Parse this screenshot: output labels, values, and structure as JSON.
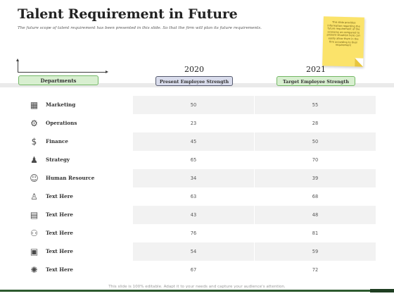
{
  "slide": {
    "title": "Talent Requirement in Future",
    "subtitle": "The  future scope of talent requirement  has been presented  in this slide. So that the firm will plan its future requirements.",
    "sticky_note": "This slide provides information regarding the future requirement of the economy as compared to present situation here can easily allow them in the firm according to their requirement"
  },
  "table": {
    "year_1": "2020",
    "year_2": "2021",
    "departments_header": "Departments",
    "col1_header": "Present Employee Strength",
    "col2_header": "Target Employee Strength",
    "rows": [
      {
        "name": "Marketing",
        "icon": "marketing-icon",
        "glyph": "▦",
        "present": "50",
        "target": "55"
      },
      {
        "name": "Operations",
        "icon": "gears-icon",
        "glyph": "⚙",
        "present": "23",
        "target": "28"
      },
      {
        "name": "Finance",
        "icon": "money-bag-icon",
        "glyph": "$",
        "present": "45",
        "target": "50"
      },
      {
        "name": "Strategy",
        "icon": "strategy-icon",
        "glyph": "♟",
        "present": "65",
        "target": "70"
      },
      {
        "name": "Human Resource",
        "icon": "hr-icon",
        "glyph": "☺",
        "present": "34",
        "target": "39"
      },
      {
        "name": "Text Here",
        "icon": "team-icon",
        "glyph": "♙",
        "present": "63",
        "target": "68"
      },
      {
        "name": "Text Here",
        "icon": "building-icon",
        "glyph": "▤",
        "present": "43",
        "target": "48"
      },
      {
        "name": "Text Here",
        "icon": "people-icon",
        "glyph": "⚇",
        "present": "76",
        "target": "81"
      },
      {
        "name": "Text Here",
        "icon": "presentation-icon",
        "glyph": "▣",
        "present": "54",
        "target": "59"
      },
      {
        "name": "Text Here",
        "icon": "settings-icon",
        "glyph": "✺",
        "present": "67",
        "target": "72"
      }
    ]
  },
  "footer": {
    "text": "This slide is 100% editable. Adapt it to your needs and capture your audience's attention."
  },
  "colors": {
    "accent_green": "#74b866",
    "footer_green": "#2d5a2f",
    "sticky_yellow": "#fbe36a"
  }
}
